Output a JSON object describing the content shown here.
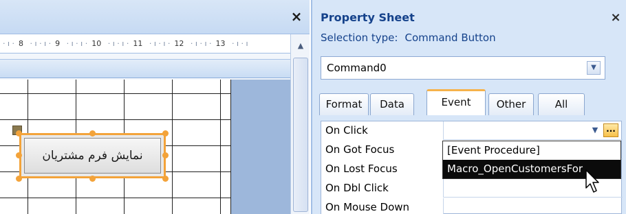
{
  "design": {
    "close_glyph": "×",
    "ruler_numbers": [
      "8",
      "9",
      "10",
      "11",
      "12",
      "13"
    ],
    "command_button_caption": "نمایش فرم مشتریان",
    "scroll_up_glyph": "▲"
  },
  "property_sheet": {
    "title": "Property Sheet",
    "close_glyph": "×",
    "selection_label": "Selection type:",
    "selection_value": "Command Button",
    "object_select_value": "Command0",
    "tabs": [
      {
        "label": "Format",
        "active": false
      },
      {
        "label": "Data",
        "active": false
      },
      {
        "label": "Event",
        "active": true
      },
      {
        "label": "Other",
        "active": false
      },
      {
        "label": "All",
        "active": false
      }
    ],
    "properties": [
      {
        "name": "On Click",
        "value": ""
      },
      {
        "name": "On Got Focus",
        "value": ""
      },
      {
        "name": "On Lost Focus",
        "value": ""
      },
      {
        "name": "On Dbl Click",
        "value": ""
      },
      {
        "name": "On Mouse Down",
        "value": ""
      }
    ],
    "builder_button_label": "...",
    "dropdown_options": [
      "[Event Procedure]",
      "Macro_OpenCustomersFor"
    ],
    "dropdown_selected_index": 1
  },
  "colors": {
    "accent_orange": "#f3a33a",
    "title_blue": "#15428b",
    "panel_bg": "#d7e6f8"
  },
  "icons": [
    "close-icon",
    "chevron-down-icon",
    "ellipsis-icon",
    "scroll-up-icon",
    "mouse-pointer-icon"
  ]
}
